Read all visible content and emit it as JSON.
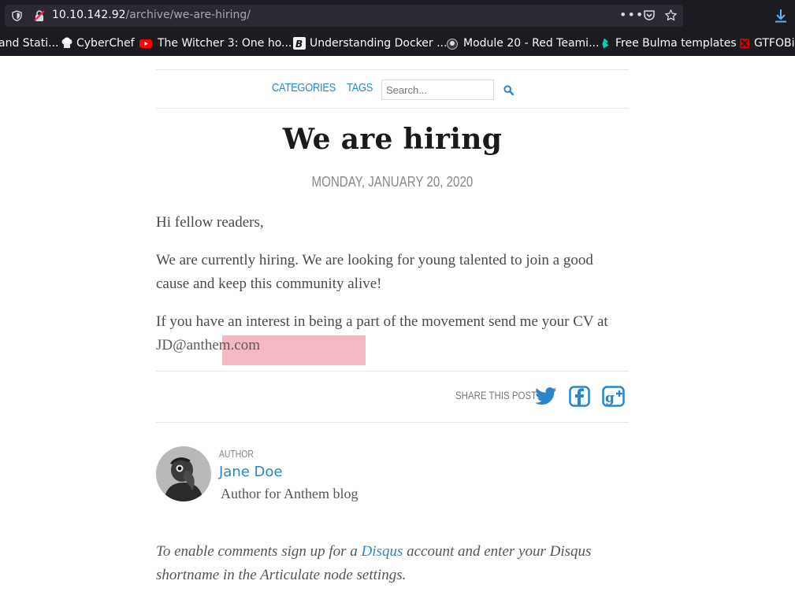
{
  "browser": {
    "url_host": "10.10.142.92",
    "url_path": "/archive/we-are-hiring/",
    "more_icon": "•••"
  },
  "bookmarks": [
    {
      "label": "and Stati...",
      "icon": "none"
    },
    {
      "label": "CyberChef",
      "icon": "chef-hat"
    },
    {
      "label": "The Witcher 3: One ho...",
      "icon": "youtube",
      "color": "#ff0000"
    },
    {
      "label": "Understanding Docker ...",
      "icon": "bookmark-b"
    },
    {
      "label": "Module 20 - Red Teami...",
      "icon": "hacker-badge"
    },
    {
      "label": "Free Bulma templates",
      "icon": "bulma",
      "color": "#00d1b2"
    },
    {
      "label": "GTFOBi",
      "icon": "gtfobins",
      "color": "#cc0000"
    }
  ],
  "nav": {
    "categories": "CATEGORIES",
    "tags": "TAGS",
    "search_placeholder": "Search..."
  },
  "post": {
    "title": "We are hiring",
    "date": "MONDAY, JANUARY 20, 2020",
    "greeting": "Hi fellow readers,",
    "paragraph1": "We are currently hiring. We are looking for young talented to join a good cause and keep this community alive!",
    "paragraph2_prefix": "If you have an interest in being a part of the movement send me your CV at ",
    "email": "JD@anthem.com"
  },
  "share": {
    "label": "SHARE THIS POST",
    "icons": [
      "twitter-icon",
      "facebook-icon",
      "google-plus-icon"
    ],
    "color": "#2a86c9"
  },
  "author": {
    "label": "AUTHOR",
    "name": "Jane Doe",
    "bio": "Author for Anthem blog"
  },
  "comments": {
    "prefix": "To enable comments sign up for a ",
    "link": "Disqus",
    "suffix": " account and enter your Disqus shortname in the Articulate node settings."
  },
  "colors": {
    "accent": "#2a86c9",
    "highlight": "#f5adb8",
    "chrome_bg": "#1c1b22"
  }
}
